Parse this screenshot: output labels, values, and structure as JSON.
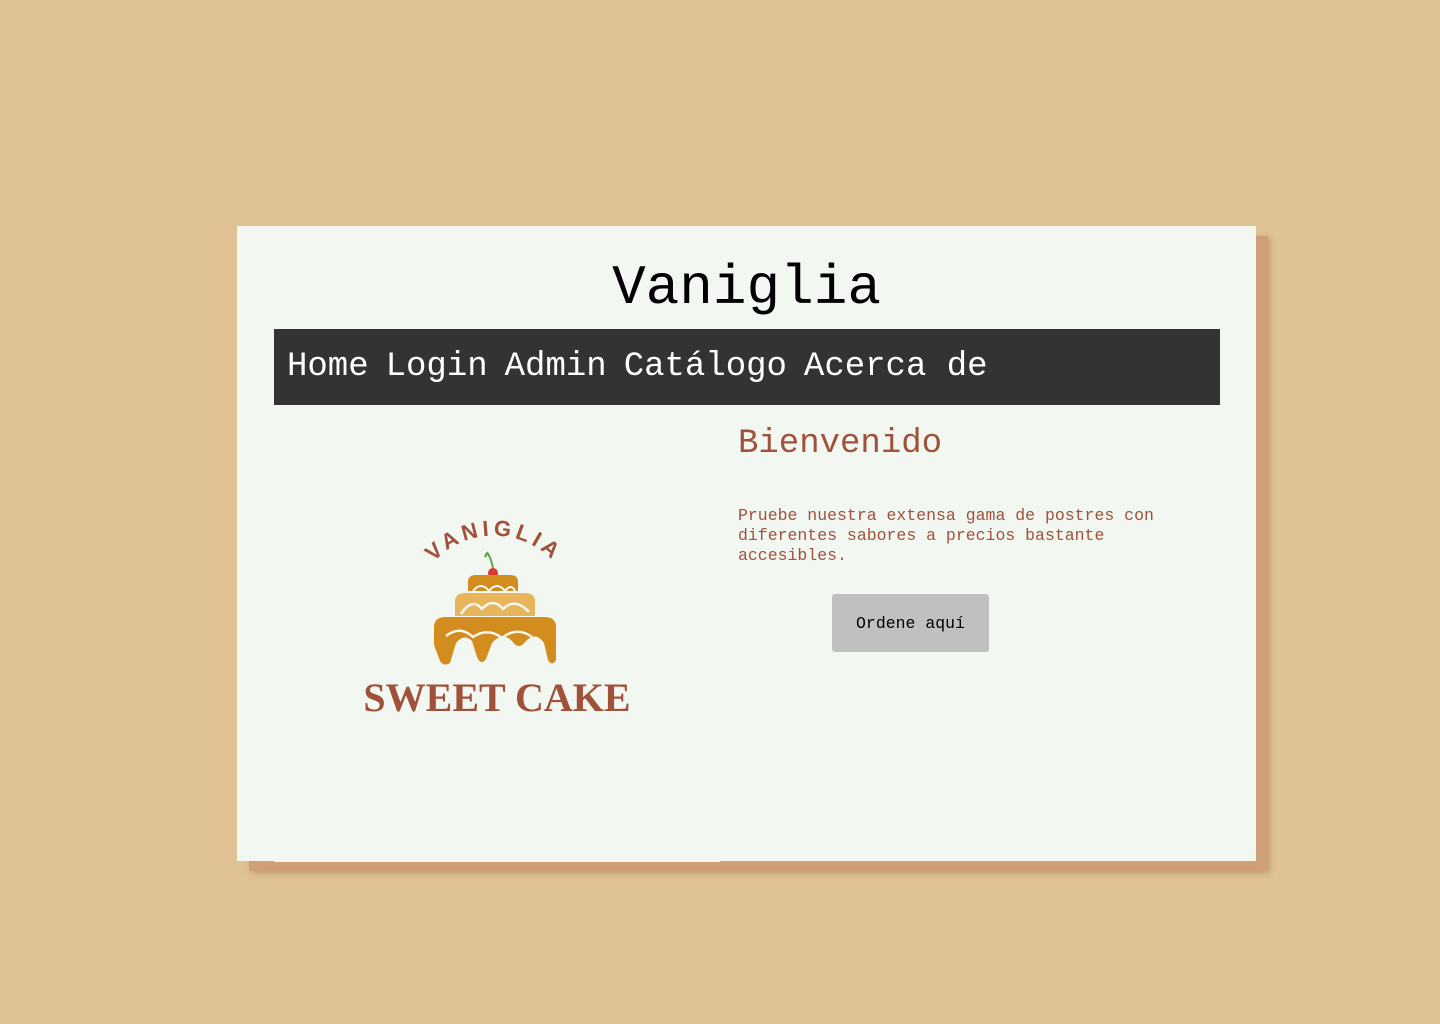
{
  "site": {
    "title": "Vaniglia"
  },
  "nav": {
    "items": [
      {
        "label": "Home"
      },
      {
        "label": "Login"
      },
      {
        "label": "Admin"
      },
      {
        "label": "Catálogo"
      },
      {
        "label": "Acerca de"
      }
    ]
  },
  "logo": {
    "top_text": "VANIGLIA",
    "bottom_text": "SWEET CAKE",
    "icon": "cake-icon"
  },
  "hero": {
    "heading": "Bienvenido",
    "description": "Pruebe nuestra extensa gama de postres con diferentes sabores a precios bastante accesibles.",
    "button_label": "Ordene aquí"
  },
  "colors": {
    "page_background": "#dfc395",
    "card_background": "#f2f7f2",
    "navbar_background": "#333333",
    "accent_text": "#a0513a",
    "button_background": "#c0c0c0",
    "cake_gold": "#d38d1f",
    "cake_light": "#e8b55a"
  }
}
